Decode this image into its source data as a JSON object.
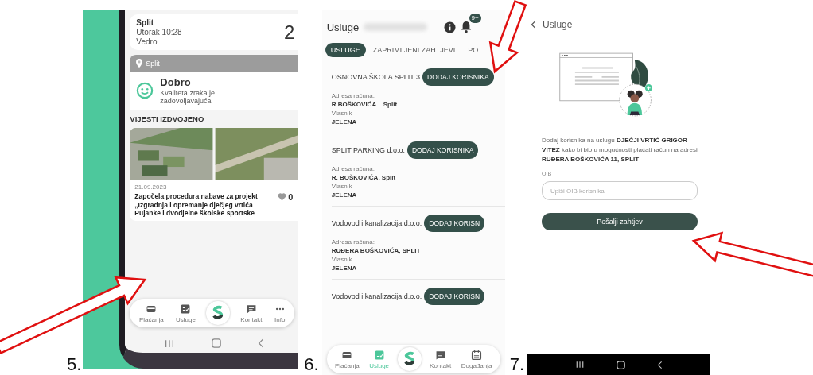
{
  "home_screen": {
    "number": "5.",
    "weather": {
      "city": "Split",
      "day_time": "Utorak 10:28",
      "condition": "Vedro",
      "temperature": "2"
    },
    "location": "Split",
    "air_quality": {
      "rating": "Dobro",
      "description": "Kvaliteta zraka je zadovoljavajuća"
    },
    "news_heading": "VIJESTI IZDVOJENO",
    "news": {
      "kind": "picture",
      "date": "21.09.2023",
      "headline": "Započela procedura nabave za projekt „Izgradnja i opremanje dječjeg vrtića Pujanke i dvodjelne školske sportske",
      "likes": "0"
    },
    "nav": [
      {
        "kind": "item",
        "label": "Plaćanja",
        "selected": false
      },
      {
        "kind": "item",
        "label": "Usluge",
        "selected": false
      },
      {
        "kind": "logo"
      },
      {
        "kind": "item",
        "label": "Kontakt",
        "selected": false
      },
      {
        "kind": "item",
        "label": "Info",
        "selected": false
      }
    ]
  },
  "services_screen": {
    "number": "6.",
    "title": "Usluge",
    "badge": "9+",
    "tabs": [
      {
        "label": "USLUGE",
        "selected": true
      },
      {
        "label": "ZAPRIMLJENI ZAHTJEVI",
        "selected": false
      },
      {
        "label": "PO",
        "selected": false
      }
    ],
    "services": [
      {
        "name": "OSNOVNA ŠKOLA SPLIT 3",
        "action": "DODAJ KORISNIKA",
        "address_label": "Adresa računa:",
        "address": "R.BOŠKOVIĆA    Split",
        "owner_label": "Vlasnik",
        "owner": "JELENA"
      },
      {
        "name": "SPLIT PARKING d.o.o.",
        "action": "DODAJ KORISNIKA",
        "address_label": "Adresa računa:",
        "address": "R. BOŠKOVIĆA, Split",
        "owner_label": "Vlasnik",
        "owner": "JELENA"
      },
      {
        "name": "Vodovod i kanalizacija d.o.o.",
        "action": "DODAJ KORISN",
        "address_label": "Adresa računa:",
        "address": "RUĐERA BOŠKOVIĆA, SPLIT",
        "owner_label": "Vlasnik",
        "owner": "JELENA"
      },
      {
        "name": "Vodovod i kanalizacija d.o.o.",
        "action": "DODAJ KORISN"
      }
    ],
    "nav": [
      {
        "kind": "item",
        "label": "Plaćanja",
        "selected": false
      },
      {
        "kind": "item",
        "label": "Usluge",
        "selected": true
      },
      {
        "kind": "logo"
      },
      {
        "kind": "item",
        "label": "Kontakt",
        "selected": false
      },
      {
        "kind": "item",
        "label": "Događanja",
        "selected": false
      }
    ]
  },
  "request_screen": {
    "number": "7.",
    "back_label": "Usluge",
    "message": "Dodaj korisnika na uslugu **DJEČJI VRTIĆ GRIGOR VITEZ** kako bi bio u mogućnosti plaćati račun na adresi **RUĐERA BOŠKOVIĆA 11, SPLIT**",
    "oib_label": "OIB",
    "oib_placeholder": "Upiši OIB korisnika",
    "submit": "Pošalji zahtjev"
  }
}
